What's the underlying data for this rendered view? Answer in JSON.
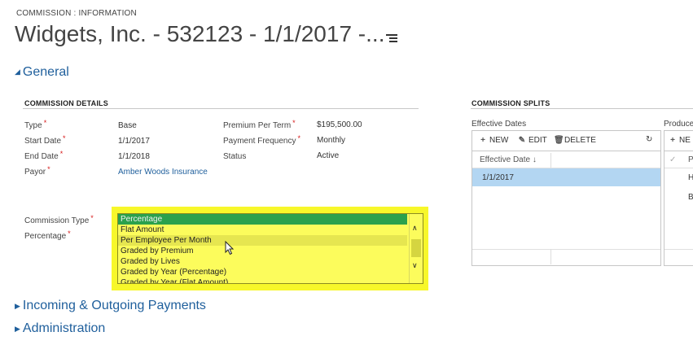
{
  "header": {
    "breadcrumb": "COMMISSION : INFORMATION",
    "title": "Widgets, Inc. - 532123 - 1/1/2017 -..."
  },
  "sections": {
    "general": "General",
    "incoming": "Incoming & Outgoing Payments",
    "administration": "Administration"
  },
  "commission_details": {
    "heading": "COMMISSION DETAILS",
    "type_label": "Type",
    "type_value": "Base",
    "start_label": "Start Date",
    "start_value": "1/1/2017",
    "end_label": "End Date",
    "end_value": "1/1/2018",
    "payor_label": "Payor",
    "payor_value": "Amber Woods Insurance",
    "premium_label": "Premium Per Term",
    "premium_value": "$195,500.00",
    "freq_label": "Payment Frequency",
    "freq_value": "Monthly",
    "status_label": "Status",
    "status_value": "Active",
    "commission_type_label": "Commission Type",
    "percentage_label": "Percentage",
    "required_mark": "*"
  },
  "commission_type_dropdown": {
    "options": [
      "Percentage",
      "Flat Amount",
      "Per Employee Per Month",
      "Graded by Premium",
      "Graded by Lives",
      "Graded by Year (Percentage)",
      "Graded by Year (Flat Amount)"
    ],
    "selected": "Percentage",
    "hovered": "Per Employee Per Month"
  },
  "commission_splits": {
    "heading": "COMMISSION SPLITS",
    "effective_dates": {
      "label": "Effective Dates",
      "new_label": "NEW",
      "edit_label": "EDIT",
      "delete_label": "DELETE",
      "column": "Effective Date",
      "sort_icon": "↓",
      "rows": [
        "1/1/2017"
      ]
    },
    "producers": {
      "label": "Produce",
      "new_label": "NE",
      "column": "P",
      "rows": [
        "H",
        "B"
      ]
    }
  },
  "colors": {
    "link": "#1f5f9c",
    "highlight": "#f7f72a",
    "selected_option": "#2aa14d",
    "selected_row": "#b3d6f2",
    "required": "#d61a1a"
  }
}
